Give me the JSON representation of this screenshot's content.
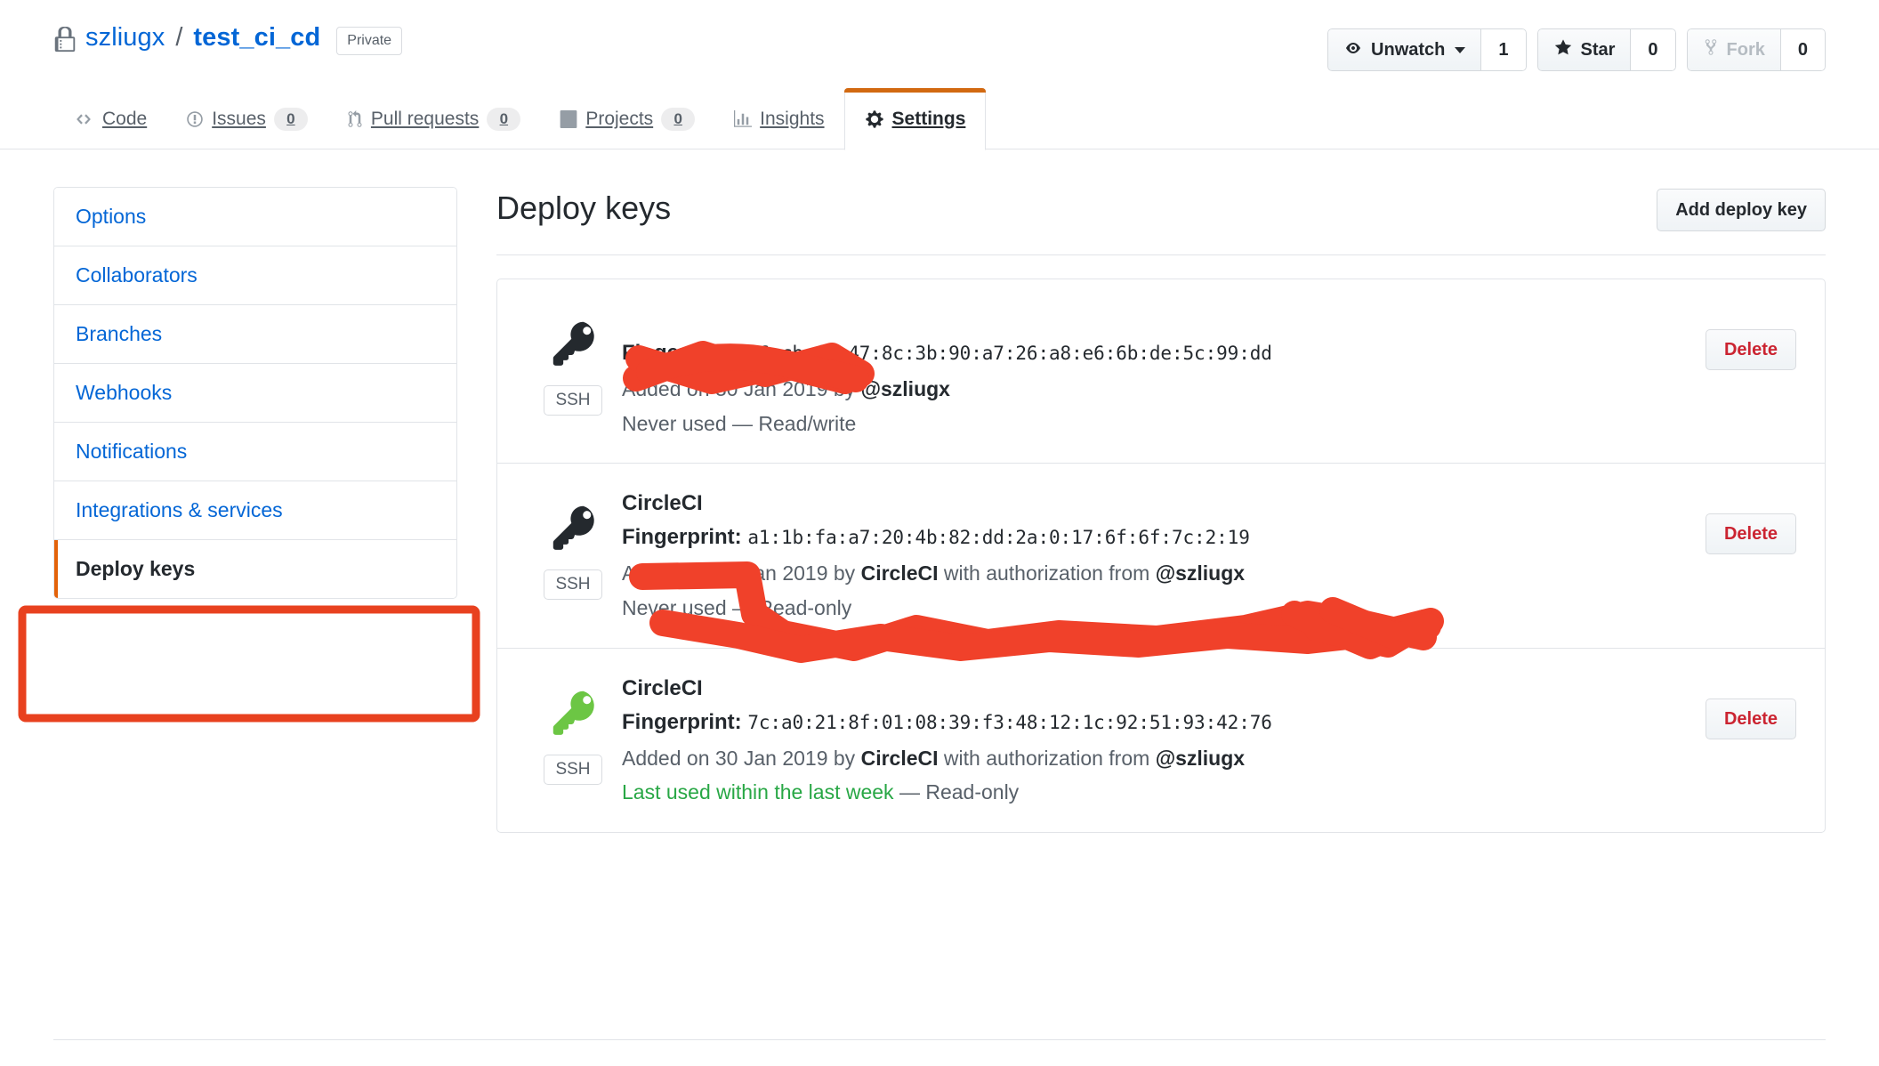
{
  "repo": {
    "lock_icon": "lock-icon",
    "owner": "szliugx",
    "separator": "/",
    "name": "test_ci_cd",
    "visibility_badge": "Private"
  },
  "social": {
    "watch": {
      "icon": "eye-icon",
      "label": "Unwatch",
      "has_caret": true,
      "count": "1"
    },
    "star": {
      "icon": "star-icon",
      "label": "Star",
      "count": "0"
    },
    "fork": {
      "icon": "fork-icon",
      "label": "Fork",
      "count": "0",
      "disabled": true
    }
  },
  "nav_tabs": [
    {
      "icon": "code-icon",
      "label": "Code",
      "count": null,
      "active": false
    },
    {
      "icon": "issue-opened-icon",
      "label": "Issues",
      "count": "0",
      "active": false
    },
    {
      "icon": "git-pull-request-icon",
      "label": "Pull requests",
      "count": "0",
      "active": false
    },
    {
      "icon": "project-icon",
      "label": "Projects",
      "count": "0",
      "active": false
    },
    {
      "icon": "graph-icon",
      "label": "Insights",
      "count": null,
      "active": false
    },
    {
      "icon": "gear-icon",
      "label": "Settings",
      "count": null,
      "active": true
    }
  ],
  "sidebar": {
    "items": [
      {
        "label": "Options",
        "selected": false
      },
      {
        "label": "Collaborators",
        "selected": false
      },
      {
        "label": "Branches",
        "selected": false
      },
      {
        "label": "Webhooks",
        "selected": false
      },
      {
        "label": "Notifications",
        "selected": false
      },
      {
        "label": "Integrations & services",
        "selected": false
      },
      {
        "label": "Deploy keys",
        "selected": true
      }
    ]
  },
  "main": {
    "title": "Deploy keys",
    "add_button": "Add deploy key",
    "fingerprint_label": "Fingerprint:",
    "delete_button": "Delete",
    "ssh_badge": "SSH"
  },
  "deploy_keys": [
    {
      "title": "",
      "title_redacted": true,
      "key_icon_color": "#24292e",
      "fingerprint": "96:cb:f4:47:8c:3b:90:a7:26:a8:e6:6b:de:5c:99:dd",
      "fingerprint_redacted": false,
      "added_prefix": "Added on",
      "added_date": "30 Jan 2019",
      "added_by_prefix": "by",
      "added_by": "@szliugx",
      "authorization_text": "",
      "authorization_user": "",
      "status_text": "Never used",
      "status_recent": false,
      "access": "— Read/write",
      "ssh_badge": "SSH",
      "delete_button": "Delete"
    },
    {
      "title": "CircleCI",
      "title_redacted": true,
      "key_icon_color": "#24292e",
      "fingerprint": "a1:1b:fa:a7:20:4b:82:dd:2a:0:17:6f:6f:7c:2:19",
      "fingerprint_redacted": true,
      "added_prefix": "Added on",
      "added_date": "30 Jan 2019",
      "added_by_prefix": "by",
      "added_by": "CircleCI",
      "authorization_text": "with authorization from",
      "authorization_user": "@szliugx",
      "status_text": "Never used",
      "status_recent": false,
      "access": "— Read-only",
      "ssh_badge": "SSH",
      "delete_button": "Delete"
    },
    {
      "title": "CircleCI",
      "title_redacted": false,
      "key_icon_color": "#6cc644",
      "fingerprint": "7c:a0:21:8f:01:08:39:f3:48:12:1c:92:51:93:42:76",
      "fingerprint_redacted": false,
      "added_prefix": "Added on",
      "added_date": "30 Jan 2019",
      "added_by_prefix": "by",
      "added_by": "CircleCI",
      "authorization_text": "with authorization from",
      "authorization_user": "@szliugx",
      "status_text": "Last used within the last week",
      "status_recent": true,
      "access": "— Read-only",
      "ssh_badge": "SSH",
      "delete_button": "Delete"
    }
  ],
  "annotations": {
    "highlight_color": "#e8411f",
    "sidebar_box": "red-rectangle-around-deploy-keys",
    "scribbles": [
      "red-scribble-over-key-1-title",
      "red-scribble-over-key-2-title-and-fingerprint"
    ]
  },
  "colors": {
    "link": "#0366d6",
    "active_tab_accent": "#d26911",
    "selected_item_accent": "#e36209",
    "delete_red": "#cb2431",
    "green_status": "#28a745",
    "green_key": "#6cc644",
    "annotation_red": "#e8411f"
  }
}
